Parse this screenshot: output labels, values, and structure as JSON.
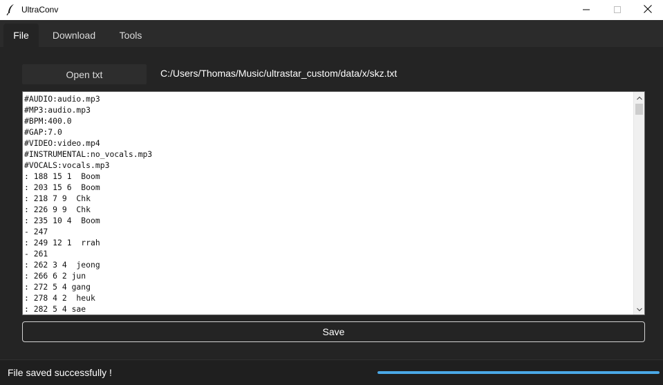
{
  "window": {
    "title": "UltraConv",
    "icon": "feather-icon",
    "controls": [
      "minimize-icon",
      "maximize-icon",
      "close-icon"
    ]
  },
  "tabs": [
    {
      "label": "File",
      "active": true
    },
    {
      "label": "Download",
      "active": false
    },
    {
      "label": "Tools",
      "active": false
    }
  ],
  "file_tab": {
    "open_label": "Open txt",
    "file_path": "C:/Users/Thomas/Music/ultrastar_custom/data/x/skz.txt",
    "editor_lines": [
      "#AUDIO:audio.mp3",
      "#MP3:audio.mp3",
      "#BPM:400.0",
      "#GAP:7.0",
      "#VIDEO:video.mp4",
      "#INSTRUMENTAL:no_vocals.mp3",
      "#VOCALS:vocals.mp3",
      ": 188 15 1  Boom",
      ": 203 15 6  Boom",
      ": 218 7 9  Chk",
      ": 226 9 9  Chk",
      ": 235 10 4  Boom",
      "- 247",
      ": 249 12 1  rrah",
      "- 261",
      ": 262 3 4  jeong",
      ": 266 6 2 jun",
      ": 272 5 4 gang",
      ": 278 4 2  heuk",
      ": 282 5 4 sae"
    ],
    "save_label": "Save"
  },
  "status": {
    "message": "File saved successfully !",
    "progress": 1.0
  },
  "colors": {
    "background": "#242424",
    "accent": "#4aa8e6",
    "text": "#ffffff"
  }
}
